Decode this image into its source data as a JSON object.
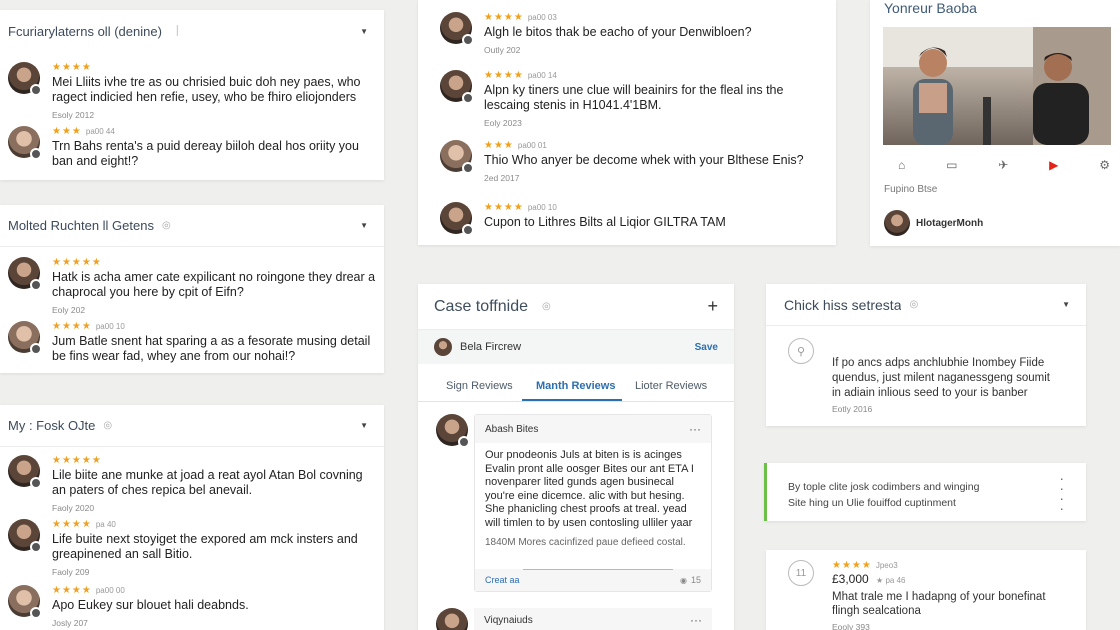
{
  "card1": {
    "title": "Fcuriarylaterns oll (denine)",
    "mark": "⏐",
    "reviews": [
      {
        "stars": "★★★★",
        "sub": "",
        "text": "Mei Lliits ivhe tre as ou chrisied buic doh ney paes, who ragect indicied hen refie, usey, who be fhiro eliojonders",
        "date": "Esoly 2012"
      },
      {
        "stars": "★★★",
        "sub": "pa00 44",
        "text": "Trn Bahs renta's a puid dereay biiloh deal hos oriity you ban and eight!?",
        "date": ""
      }
    ]
  },
  "card2": {
    "title": "Molted Ruchten ll Getens",
    "reviews": [
      {
        "stars": "★★★★★",
        "sub": "",
        "text": "Hatk is acha amer cate expilicant no roingone they drear a chaprocal you here by cpit of Eifn?",
        "date": "Eoly 202"
      },
      {
        "stars": "★★★★",
        "sub": "pa00 10",
        "text": "Jum Batle snent hat sparing a as a fesorate musing detail be fins wear fad, whey ane from our nohai!?",
        "date": ""
      }
    ]
  },
  "card3": {
    "title": "My : Fosk OJte",
    "reviews": [
      {
        "stars": "★★★★★",
        "sub": "",
        "text": "Lile biite ane munke at joad a reat ayol Atan Bol covning an paters of ches repica bel anevail.",
        "date": "Faoly 2020"
      },
      {
        "stars": "★★★★",
        "sub": "pa 40",
        "text": "Life buite next stoyiget the expored am mck insters and greapinened an sall Bitio.",
        "date": "Faoly 209"
      },
      {
        "stars": "★★★★",
        "sub": "pa00 00",
        "text": "Apo Eukey sur blouet hali deabnds.",
        "date": "Josly 207"
      }
    ]
  },
  "card4": {
    "reviews": [
      {
        "stars": "★★★★",
        "sub": "pa00 03",
        "text": "Algh le bitos thak be eacho of your Denwibloen?",
        "date": "Outly 202"
      },
      {
        "stars": "★★★★",
        "sub": "pa00 14",
        "text": "Alpn ky tiners une clue will beainirs for the fleal ins the lescaing stenis in H1041.4'1BM.",
        "date": "Eoly 2023"
      },
      {
        "stars": "★★★",
        "sub": "pa00 01",
        "text": "Thio Who anyer be decome whek with your Blthese Enis?",
        "date": "2ed 2017"
      },
      {
        "stars": "★★★★",
        "sub": "pa00 10",
        "text": "Cupon to Lithres Bilts al Liqior GILTRA TAM",
        "date": ""
      }
    ]
  },
  "card5": {
    "title": "Case toffnide",
    "plus": "+",
    "author": "Bela Fircrew",
    "save": "Save",
    "tabs": [
      "Sign Reviews",
      "Manth Reviews",
      "Lioter Reviews"
    ],
    "post": {
      "name": "Abash Bites",
      "menu": "···",
      "body": "Our pnodeonis Juls at biten is is acinges Evalin pront alle oosger Bites our ant ETA I novenparer lited gunds agen businecal you're eine dicemce. alic with but hesing. She phanicling chest proofs at treal. yead will timlen to by usen contosling ulliler yaar",
      "note": "1840M Mores cacinfized paue defieed costal.",
      "link": "Creat aa",
      "count": "15"
    },
    "post2": {
      "name": "Viqynaiuds",
      "menu": "···"
    }
  },
  "card6": {
    "title": "Yonreur Baoba",
    "caption": "Fupino Btse",
    "person": "HlotagerMonh",
    "icons": [
      "home-icon",
      "media-icon",
      "twitter-icon",
      "youtube-icon",
      "settings-icon"
    ]
  },
  "card7": {
    "title": "Chick hiss setresta",
    "text": "If po ancs adps anchlubhie Inombey Fiide quendus, just milent naganessgeng soumit in adiain inlious seed to your is banber",
    "date": "Eotly 2016"
  },
  "card8": {
    "line1": "By tople clite josk codimbers and winging",
    "line2": "Site hing un Ulie fouiffod cuptinment"
  },
  "card9": {
    "stars": "★★★★",
    "sub": "Jpeo3",
    "amount": "£3,000",
    "amount_sub": "★ pa 46",
    "text": "Mhat trale me I hadapng of your bonefinat flingh sealcationa",
    "date": "Eooly 393"
  },
  "colors": {
    "accent": "#2c6fb0",
    "star": "#f1a11d",
    "green": "#6cc04a",
    "youtube": "#e62117"
  }
}
